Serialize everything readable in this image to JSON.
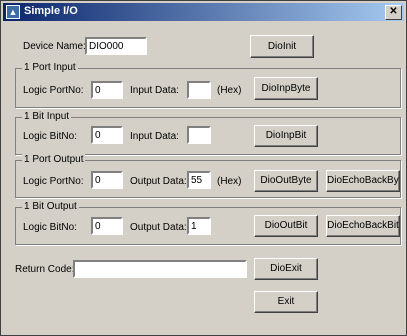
{
  "window": {
    "title": "Simple I/O",
    "close_glyph": "✕"
  },
  "device": {
    "name_label": "Device Name:",
    "name_value": "DIO000",
    "init_button": "DioInit"
  },
  "port_input": {
    "legend": "1 Port Input",
    "port_label": "Logic PortNo:",
    "port_value": "0",
    "data_label": "Input Data:",
    "data_value": "",
    "unit": "(Hex)",
    "button": "DioInpByte"
  },
  "bit_input": {
    "legend": "1 Bit Input",
    "bit_label": "Logic BitNo:",
    "bit_value": "0",
    "data_label": "Input Data:",
    "data_value": "",
    "button": "DioInpBit"
  },
  "port_output": {
    "legend": "1 Port Output",
    "port_label": "Logic PortNo:",
    "port_value": "0",
    "data_label": "Output Data:",
    "data_value": "55",
    "unit": "(Hex)",
    "button": "DioOutByte",
    "echo_button": "DioEchoBackByte"
  },
  "bit_output": {
    "legend": "1 Bit Output",
    "bit_label": "Logic BitNo:",
    "bit_value": "0",
    "data_label": "Output Data:",
    "data_value": "1",
    "button": "DioOutBit",
    "echo_button": "DioEchoBackBit"
  },
  "footer": {
    "return_label": "Return Code:",
    "return_value": "",
    "exit_dio_button": "DioExit",
    "exit_button": "Exit"
  }
}
